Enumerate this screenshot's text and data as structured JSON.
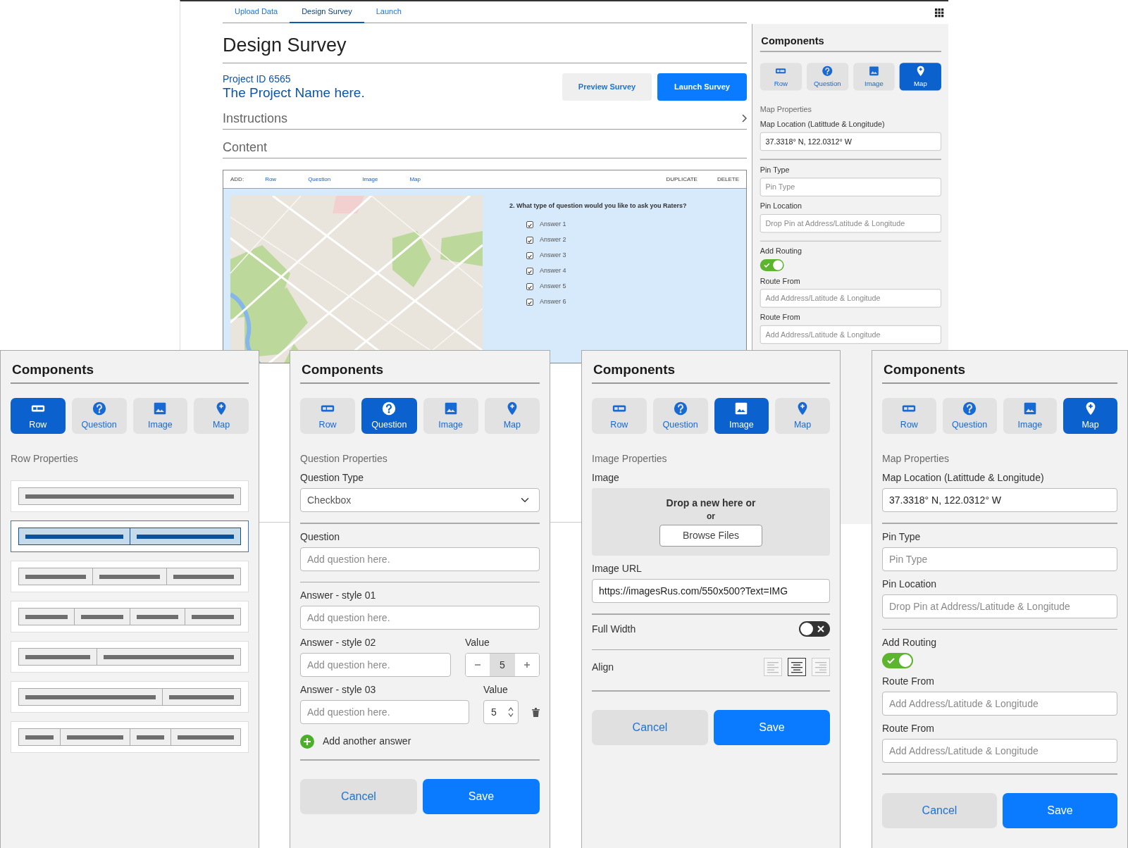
{
  "main_window": {
    "tabs": [
      {
        "label": "Upload Data",
        "selected": false
      },
      {
        "label": "Design Survey",
        "selected": true
      },
      {
        "label": "Launch",
        "selected": false
      }
    ],
    "title": "Design Survey",
    "project_id": "Project ID 6565",
    "project_name": "The Project Name here.",
    "buttons": [
      {
        "label": "Preview Survey",
        "kind": "secondary"
      },
      {
        "label": "Launch Survey",
        "kind": "primary"
      }
    ],
    "sections": [
      {
        "title": "Instructions",
        "expandable": true
      },
      {
        "title": "Content",
        "expandable": false
      }
    ],
    "content_toolbar": {
      "add_label": "ADD:",
      "add_links": [
        "Row",
        "Question",
        "Image",
        "Map"
      ],
      "actions": [
        "DUPLICATE",
        "DELETE"
      ]
    },
    "content_block": {
      "question": "2. What type of question would you like to ask you Raters?",
      "answers": [
        {
          "label": "Answer 1",
          "checked": true
        },
        {
          "label": "Answer 2",
          "checked": true
        },
        {
          "label": "Answer 3",
          "checked": true
        },
        {
          "label": "Answer 4",
          "checked": true
        },
        {
          "label": "Answer 5",
          "checked": true
        },
        {
          "label": "Answer 6",
          "checked": true
        }
      ]
    },
    "sidebar": {
      "title": "Components",
      "components": [
        {
          "label": "Row",
          "selected": false
        },
        {
          "label": "Question",
          "selected": false
        },
        {
          "label": "Image",
          "selected": false
        },
        {
          "label": "Map",
          "selected": true
        }
      ],
      "items": [
        {
          "kind": "heading",
          "text": "Map Properties"
        },
        {
          "kind": "label",
          "text": "Map Location (Latittude & Longitude)"
        },
        {
          "kind": "input",
          "value": "37.3318° N, 122.0312° W"
        },
        {
          "kind": "divider"
        },
        {
          "kind": "label",
          "text": "Pin Type"
        },
        {
          "kind": "input",
          "placeholder": "Pin Type"
        },
        {
          "kind": "label",
          "text": "Pin Location"
        },
        {
          "kind": "input",
          "placeholder": "Drop Pin at Address/Latitude & Longitude"
        },
        {
          "kind": "divider"
        },
        {
          "kind": "label",
          "text": "Add Routing"
        },
        {
          "kind": "switch",
          "on": true
        },
        {
          "kind": "label",
          "text": "Route From"
        },
        {
          "kind": "input",
          "placeholder": "Add Address/Latitude & Longitude"
        },
        {
          "kind": "label",
          "text": "Route From"
        },
        {
          "kind": "input",
          "placeholder": "Add Address/Latitude & Longitude"
        }
      ]
    }
  },
  "panels": [
    {
      "title": "Components",
      "components": [
        {
          "label": "Row",
          "selected": true
        },
        {
          "label": "Question",
          "selected": false
        },
        {
          "label": "Image",
          "selected": false
        },
        {
          "label": "Map",
          "selected": false
        }
      ],
      "items": [
        {
          "kind": "heading",
          "text": "Row Properties"
        },
        {
          "kind": "layouts",
          "options": [
            {
              "selected": false
            },
            {
              "selected": true
            },
            {
              "selected": false
            },
            {
              "selected": false
            },
            {
              "selected": false
            },
            {
              "selected": false
            },
            {
              "selected": false
            }
          ]
        }
      ]
    },
    {
      "title": "Components",
      "components": [
        {
          "label": "Row",
          "selected": false
        },
        {
          "label": "Question",
          "selected": true
        },
        {
          "label": "Image",
          "selected": false
        },
        {
          "label": "Map",
          "selected": false
        }
      ],
      "items": [
        {
          "kind": "heading",
          "text": "Question Properties"
        },
        {
          "kind": "label",
          "text": "Question Type"
        },
        {
          "kind": "select",
          "value": "Checkbox"
        },
        {
          "kind": "divider"
        },
        {
          "kind": "label",
          "text": "Question"
        },
        {
          "kind": "input",
          "placeholder": "Add question here."
        },
        {
          "kind": "divider"
        },
        {
          "kind": "label",
          "text": "Answer - style 01"
        },
        {
          "kind": "input",
          "placeholder": "Add question here."
        },
        {
          "kind": "stepper_row",
          "label": "Answer - style 02",
          "value_label": "Value",
          "placeholder": "Add question here.",
          "value": "5"
        },
        {
          "kind": "spinner_row",
          "label": "Answer - style 03",
          "value_label": "Value",
          "placeholder": "Add question here.",
          "value": "5"
        },
        {
          "kind": "add_link",
          "text": "Add another answer"
        },
        {
          "kind": "divider"
        }
      ],
      "footer": [
        {
          "label": "Cancel",
          "kind": "secondary"
        },
        {
          "label": "Save",
          "kind": "primary"
        }
      ]
    },
    {
      "title": "Components",
      "components": [
        {
          "label": "Row",
          "selected": false
        },
        {
          "label": "Question",
          "selected": false
        },
        {
          "label": "Image",
          "selected": true
        },
        {
          "label": "Map",
          "selected": false
        }
      ],
      "items": [
        {
          "kind": "heading",
          "text": "Image Properties"
        },
        {
          "kind": "label",
          "text": "Image"
        },
        {
          "kind": "drop_area",
          "text": "Drop a new here or",
          "or": "or",
          "button": "Browse Files"
        },
        {
          "kind": "label",
          "text": "Image URL"
        },
        {
          "kind": "input",
          "value": "https://imagesRus.com/550x500?Text=IMG"
        },
        {
          "kind": "divider"
        },
        {
          "kind": "switch_row",
          "label": "Full Width",
          "on": false
        },
        {
          "kind": "divider"
        },
        {
          "kind": "align",
          "label": "Align",
          "options": [
            {
              "selected": false
            },
            {
              "selected": true
            },
            {
              "selected": false
            }
          ]
        },
        {
          "kind": "divider"
        }
      ],
      "footer": [
        {
          "label": "Cancel",
          "kind": "secondary"
        },
        {
          "label": "Save",
          "kind": "primary"
        }
      ]
    },
    {
      "title": "Components",
      "components": [
        {
          "label": "Row",
          "selected": false
        },
        {
          "label": "Question",
          "selected": false
        },
        {
          "label": "Image",
          "selected": false
        },
        {
          "label": "Map",
          "selected": true
        }
      ],
      "items": [
        {
          "kind": "heading",
          "text": "Map Properties"
        },
        {
          "kind": "label",
          "text": "Map Location (Latittude & Longitude)"
        },
        {
          "kind": "input",
          "value": "37.3318° N, 122.0312° W"
        },
        {
          "kind": "divider"
        },
        {
          "kind": "label",
          "text": "Pin Type"
        },
        {
          "kind": "input",
          "placeholder": "Pin Type"
        },
        {
          "kind": "label",
          "text": "Pin Location"
        },
        {
          "kind": "input",
          "placeholder": "Drop Pin at Address/Latitude & Longitude"
        },
        {
          "kind": "divider"
        },
        {
          "kind": "label",
          "text": "Add Routing"
        },
        {
          "kind": "switch",
          "on": true
        },
        {
          "kind": "label",
          "text": "Route From"
        },
        {
          "kind": "input",
          "placeholder": "Add Address/Latitude & Longitude"
        },
        {
          "kind": "label",
          "text": "Route From"
        },
        {
          "kind": "input",
          "placeholder": "Add Address/Latitude & Longitude"
        },
        {
          "kind": "divider"
        }
      ],
      "footer": [
        {
          "label": "Cancel",
          "kind": "secondary"
        },
        {
          "label": "Save",
          "kind": "primary"
        }
      ]
    }
  ]
}
